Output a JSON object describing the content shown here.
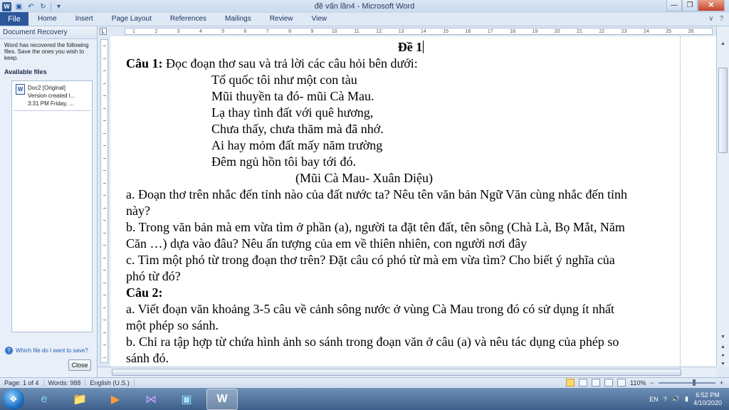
{
  "window": {
    "title": "đề vấn lần4 - Microsoft Word"
  },
  "ribbon": {
    "tabs": [
      "File",
      "Home",
      "Insert",
      "Page Layout",
      "References",
      "Mailings",
      "Review",
      "View"
    ]
  },
  "recovery_pane": {
    "title": "Document Recovery",
    "message": "Word has recovered the following files. Save the ones you wish to keep.",
    "available_label": "Available files",
    "files": [
      {
        "name": "Doc2  [Original]",
        "line2": "Version created l...",
        "line3": "3:31 PM Friday, ..."
      }
    ],
    "help_link": "Which file do I want to save?",
    "close_label": "Close"
  },
  "ruler": {
    "ticks": [
      "1",
      "2",
      "3",
      "4",
      "5",
      "6",
      "7",
      "8",
      "9",
      "10",
      "11",
      "12",
      "13",
      "14",
      "15",
      "16",
      "17",
      "18",
      "19",
      "20",
      "21",
      "22",
      "23",
      "24",
      "25",
      "26"
    ]
  },
  "document": {
    "heading": "Đề 1",
    "q1_label": "Câu 1:",
    "q1_text": " Đọc đoạn thơ sau và trả lời các câu hỏi bên dưới:",
    "poem": [
      "Tổ quốc tôi như một con tàu",
      "Mũi thuyền ta đó- mũi Cà Mau.",
      "Lạ thay tình đất với quê hương,",
      "Chưa thấy, chưa thăm mà đã nhớ.",
      "Ai hay mỏm đất mấy năm trường",
      "Đêm ngủ hồn tôi bay tới đó."
    ],
    "source": "(Mũi Cà Mau- Xuân Diệu)",
    "q1_lines": [
      "a. Đoạn thơ trên nhắc đến tỉnh nào của đất nước ta? Nêu tên văn bản Ngữ Văn cùng nhắc đến tỉnh",
      "này?",
      "b. Trong văn bản mà em vừa tìm ở phần (a), người ta đặt tên đất, tên sông (Chà Là, Bọ Mắt, Năm",
      "Căn …) dựa vào đâu? Nêu ấn tượng của em về thiên nhiên, con người nơi đây",
      "c. Tìm một phó từ trong đoạn thơ trên? Đặt câu có phó từ mà em vừa tìm? Cho biết ý nghĩa của",
      "phó từ đó?"
    ],
    "q2_label": "Câu 2:",
    "q2_lines": [
      "a. Viết đoạn văn khoảng 3-5 câu về cảnh sông nước ở vùng Cà Mau trong đó có sử dụng ít nhất",
      "một phép so sánh.",
      "b. Chỉ ra tập hợp từ chứa hình ảnh so sánh trong đoạn văn ở câu (a) và nêu tác dụng của phép so",
      "sánh đó."
    ]
  },
  "status_bar": {
    "page": "Page: 1 of 4",
    "words": "Words: 988",
    "language": "English (U.S.)",
    "zoom": "110%"
  },
  "taskbar": {
    "language": "EN",
    "time": "6:52 PM",
    "date": "4/10/2020"
  }
}
